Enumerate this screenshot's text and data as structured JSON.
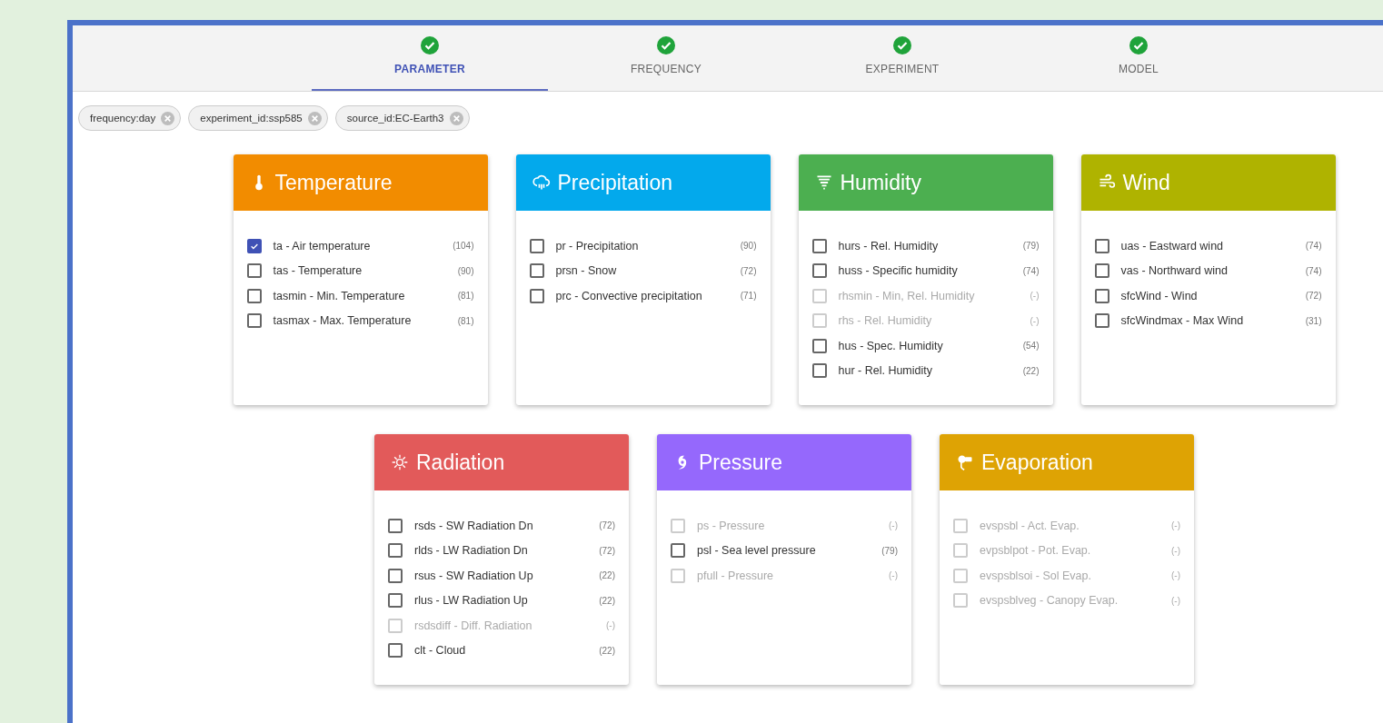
{
  "steps": [
    {
      "label": "PARAMETER",
      "done": true,
      "selected": true
    },
    {
      "label": "FREQUENCY",
      "done": true,
      "selected": false
    },
    {
      "label": "EXPERIMENT",
      "done": true,
      "selected": false
    },
    {
      "label": "MODEL",
      "done": true,
      "selected": false
    }
  ],
  "filters": [
    "frequency:day",
    "experiment_id:ssp585",
    "source_id:EC-Earth3"
  ],
  "categories": [
    {
      "title": "Temperature",
      "color": "#f28c00",
      "items": [
        {
          "label": "ta - Air temperature",
          "count": "(104)",
          "checked": true,
          "disabled": false
        },
        {
          "label": "tas - Temperature",
          "count": "(90)",
          "checked": false,
          "disabled": false
        },
        {
          "label": "tasmin - Min. Temperature",
          "count": "(81)",
          "checked": false,
          "disabled": false
        },
        {
          "label": "tasmax - Max. Temperature",
          "count": "(81)",
          "checked": false,
          "disabled": false
        }
      ]
    },
    {
      "title": "Precipitation",
      "color": "#03a9ec",
      "items": [
        {
          "label": "pr - Precipitation",
          "count": "(90)",
          "checked": false,
          "disabled": false
        },
        {
          "label": "prsn - Snow",
          "count": "(72)",
          "checked": false,
          "disabled": false
        },
        {
          "label": "prc - Convective precipitation",
          "count": "(71)",
          "checked": false,
          "disabled": false
        }
      ]
    },
    {
      "title": "Humidity",
      "color": "#4caf50",
      "items": [
        {
          "label": "hurs - Rel. Humidity",
          "count": "(79)",
          "checked": false,
          "disabled": false
        },
        {
          "label": "huss - Specific humidity",
          "count": "(74)",
          "checked": false,
          "disabled": false
        },
        {
          "label": "rhsmin - Min, Rel. Humidity",
          "count": "(-)",
          "checked": false,
          "disabled": true
        },
        {
          "label": "rhs - Rel. Humidity",
          "count": "(-)",
          "checked": false,
          "disabled": true
        },
        {
          "label": "hus - Spec. Humidity",
          "count": "(54)",
          "checked": false,
          "disabled": false
        },
        {
          "label": "hur - Rel. Humidity",
          "count": "(22)",
          "checked": false,
          "disabled": false
        }
      ]
    },
    {
      "title": "Wind",
      "color": "#afb300",
      "items": [
        {
          "label": "uas - Eastward wind",
          "count": "(74)",
          "checked": false,
          "disabled": false
        },
        {
          "label": "vas - Northward wind",
          "count": "(74)",
          "checked": false,
          "disabled": false
        },
        {
          "label": "sfcWind - Wind",
          "count": "(72)",
          "checked": false,
          "disabled": false
        },
        {
          "label": "sfcWindmax - Max Wind",
          "count": "(31)",
          "checked": false,
          "disabled": false
        }
      ]
    },
    {
      "title": "Radiation",
      "color": "#e25a5a",
      "items": [
        {
          "label": "rsds - SW Radiation Dn",
          "count": "(72)",
          "checked": false,
          "disabled": false
        },
        {
          "label": "rlds - LW Radiation Dn",
          "count": "(72)",
          "checked": false,
          "disabled": false
        },
        {
          "label": "rsus - SW Radiation Up",
          "count": "(22)",
          "checked": false,
          "disabled": false
        },
        {
          "label": "rlus - LW Radiation Up",
          "count": "(22)",
          "checked": false,
          "disabled": false
        },
        {
          "label": "rsdsdiff - Diff. Radiation",
          "count": "(-)",
          "checked": false,
          "disabled": true
        },
        {
          "label": "clt - Cloud",
          "count": "(22)",
          "checked": false,
          "disabled": false
        }
      ]
    },
    {
      "title": "Pressure",
      "color": "#9568fc",
      "items": [
        {
          "label": "ps - Pressure",
          "count": "(-)",
          "checked": false,
          "disabled": true
        },
        {
          "label": "psl - Sea level pressure",
          "count": "(79)",
          "checked": false,
          "disabled": false
        },
        {
          "label": "pfull - Pressure",
          "count": "(-)",
          "checked": false,
          "disabled": true
        }
      ]
    },
    {
      "title": "Evaporation",
      "color": "#dea304",
      "items": [
        {
          "label": "evspsbl - Act. Evap.",
          "count": "(-)",
          "checked": false,
          "disabled": true
        },
        {
          "label": "evpsblpot - Pot. Evap.",
          "count": "(-)",
          "checked": false,
          "disabled": true
        },
        {
          "label": "evspsblsoi - Sol Evap.",
          "count": "(-)",
          "checked": false,
          "disabled": true
        },
        {
          "label": "evspsblveg - Canopy Evap.",
          "count": "(-)",
          "checked": false,
          "disabled": true
        }
      ]
    }
  ]
}
